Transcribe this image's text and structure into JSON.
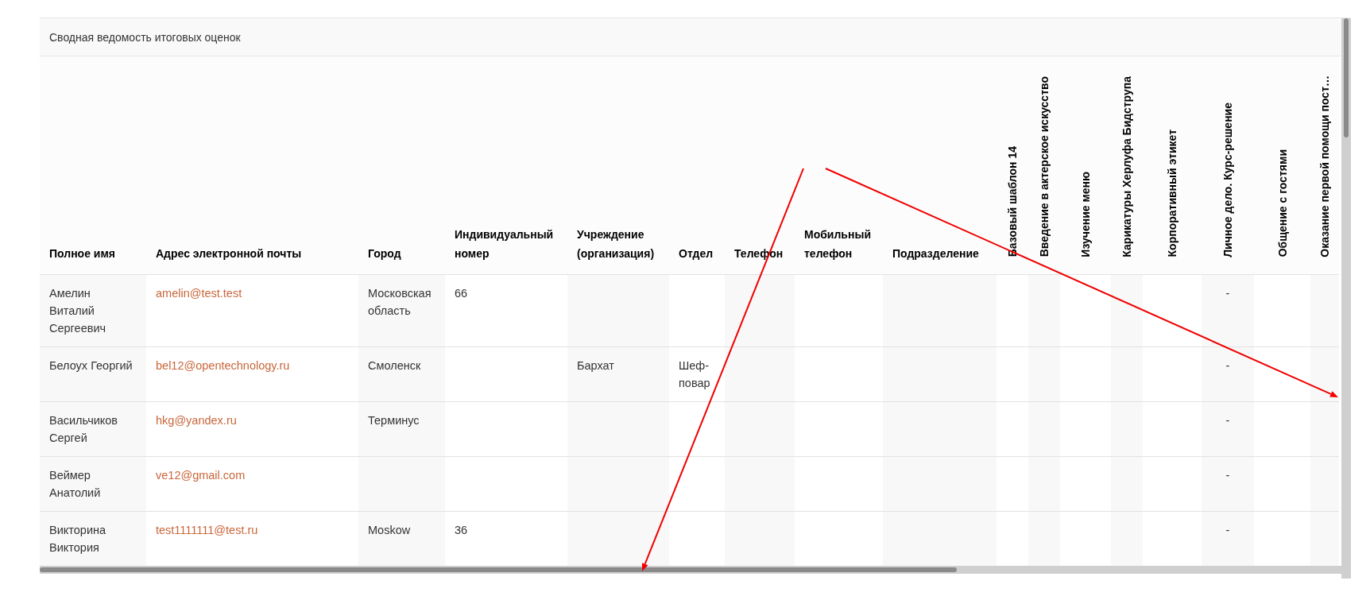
{
  "report": {
    "title": "Сводная ведомость итоговых оценок"
  },
  "table": {
    "columns": [
      {
        "label": "Полное имя",
        "kind": "text"
      },
      {
        "label": "Адрес электронной почты",
        "kind": "email"
      },
      {
        "label": "Город",
        "kind": "text"
      },
      {
        "label": "Индивидуальный номер",
        "kind": "text"
      },
      {
        "label": "Учреждение (организация)",
        "kind": "text"
      },
      {
        "label": "Отдел",
        "kind": "text"
      },
      {
        "label": "Телефон",
        "kind": "text"
      },
      {
        "label": "Мобильный телефон",
        "kind": "text"
      },
      {
        "label": "Подразделение",
        "kind": "text"
      },
      {
        "label": "Базовый шаблон 14",
        "kind": "grade"
      },
      {
        "label": "Введение в актерское искусство",
        "kind": "grade"
      },
      {
        "label": "Изучение меню",
        "kind": "grade"
      },
      {
        "label": "Карикатуры Херлуфа Бидструпа",
        "kind": "grade"
      },
      {
        "label": "Корпоративный этикет",
        "kind": "grade"
      },
      {
        "label": "Личное дело. Курс-решение",
        "kind": "grade"
      },
      {
        "label": "Общение с гостями",
        "kind": "grade"
      },
      {
        "label": "Оказание первой помощи пост…",
        "kind": "grade"
      }
    ],
    "rows": [
      {
        "cells": [
          "Амелин Виталий Сергеевич",
          "amelin@test.test",
          "Московская область",
          "66",
          null,
          null,
          null,
          null,
          null,
          null,
          null,
          null,
          null,
          null,
          "-",
          null,
          null
        ]
      },
      {
        "cells": [
          "Белоух Георгий",
          "bel12@opentechnology.ru",
          "Смоленск",
          null,
          "Бархат",
          "Шеф-повар",
          null,
          null,
          null,
          null,
          null,
          null,
          null,
          null,
          "-",
          null,
          null
        ]
      },
      {
        "cells": [
          "Васильчиков Сергей",
          "hkg@yandex.ru",
          "Терминус",
          null,
          null,
          null,
          null,
          null,
          null,
          null,
          null,
          null,
          null,
          null,
          "-",
          null,
          null
        ]
      },
      {
        "cells": [
          "Веймер Анатолий",
          "ve12@gmail.com",
          null,
          null,
          null,
          null,
          null,
          null,
          null,
          null,
          null,
          null,
          null,
          null,
          "-",
          null,
          null
        ]
      },
      {
        "cells": [
          "Викторина Виктория",
          "test1111111@test.ru",
          "Moskow",
          "36",
          null,
          null,
          null,
          null,
          null,
          null,
          null,
          null,
          null,
          null,
          "-",
          null,
          null
        ]
      }
    ]
  }
}
